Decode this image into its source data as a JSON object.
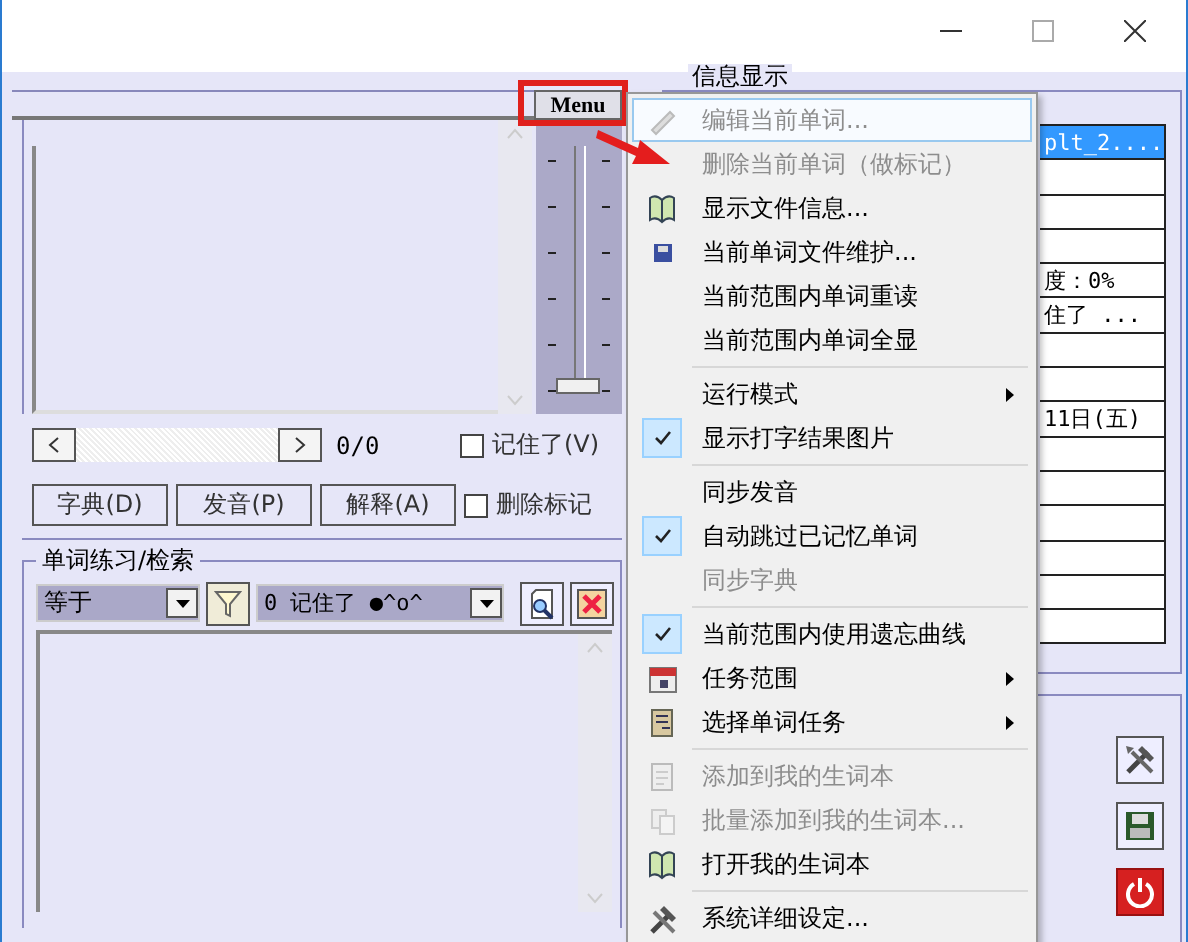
{
  "menu_button": {
    "label": "Menu",
    "highlighted": true
  },
  "speed_slider": {
    "level": 0
  },
  "navigator": {
    "counter": "0/0",
    "remembered": {
      "label": "记住了(V)",
      "checked": false
    }
  },
  "buttons": [
    "字典(D)",
    "发音(P)",
    "解释(A)"
  ],
  "delete_mark": {
    "label": "删除标记",
    "checked": false
  },
  "practice": {
    "title": "单词练习/检索",
    "match_select": "等于",
    "status_select": "0 记住了 ●^o^"
  },
  "info": {
    "title": "信息显示",
    "rows": [
      {
        "text": "plt_2....",
        "selected": true
      },
      {
        "selected": false
      },
      {
        "selected": false
      },
      {
        "selected": false
      },
      {
        "text": "度：0%",
        "selected": false
      },
      {
        "text": "住了  ...",
        "selected": false
      },
      {
        "selected": false
      },
      {
        "selected": false
      },
      {
        "text": "11日(五)",
        "selected": false
      },
      {
        "selected": false
      },
      {
        "selected": false
      },
      {
        "selected": false
      },
      {
        "selected": false
      },
      {
        "selected": false
      },
      {
        "selected": false
      }
    ]
  },
  "menu": [
    {
      "kind": "item",
      "label": "编辑当前单词...",
      "disabled": true,
      "highlighted": true
    },
    {
      "kind": "item",
      "label": "删除当前单词（做标记）",
      "disabled": true,
      "highlighted": false
    },
    {
      "kind": "item",
      "label": "显示文件信息...",
      "disabled": false,
      "highlighted": false
    },
    {
      "kind": "item",
      "label": "当前单词文件维护...",
      "disabled": false,
      "highlighted": false
    },
    {
      "kind": "item",
      "label": "当前范围内单词重读",
      "disabled": false,
      "highlighted": false
    },
    {
      "kind": "item",
      "label": "当前范围内单词全显",
      "disabled": false,
      "highlighted": false
    },
    {
      "kind": "separator"
    },
    {
      "kind": "item",
      "label": "运行模式",
      "disabled": false,
      "highlighted": false,
      "submenu": true
    },
    {
      "kind": "item",
      "label": "显示打字结果图片",
      "disabled": false,
      "highlighted": false,
      "checked": true
    },
    {
      "kind": "separator"
    },
    {
      "kind": "item",
      "label": "同步发音",
      "disabled": false,
      "highlighted": false,
      "checked": false
    },
    {
      "kind": "item",
      "label": "自动跳过已记忆单词",
      "disabled": false,
      "highlighted": false,
      "checked": true
    },
    {
      "kind": "item",
      "label": "同步字典",
      "disabled": true,
      "highlighted": false,
      "checked": false
    },
    {
      "kind": "separator"
    },
    {
      "kind": "item",
      "label": "当前范围内使用遗忘曲线",
      "disabled": false,
      "highlighted": false,
      "checked": true
    },
    {
      "kind": "item",
      "label": "任务范围",
      "disabled": false,
      "highlighted": false,
      "submenu": true
    },
    {
      "kind": "item",
      "label": "选择单词任务",
      "disabled": false,
      "highlighted": false,
      "submenu": true
    },
    {
      "kind": "separator"
    },
    {
      "kind": "item",
      "label": "添加到我的生词本",
      "disabled": true,
      "highlighted": false
    },
    {
      "kind": "item",
      "label": "批量添加到我的生词本...",
      "disabled": true,
      "highlighted": false
    },
    {
      "kind": "item",
      "label": "打开我的生词本",
      "disabled": false,
      "highlighted": false
    },
    {
      "kind": "separator"
    },
    {
      "kind": "item",
      "label": "系统详细设定...",
      "disabled": false,
      "highlighted": false
    }
  ]
}
